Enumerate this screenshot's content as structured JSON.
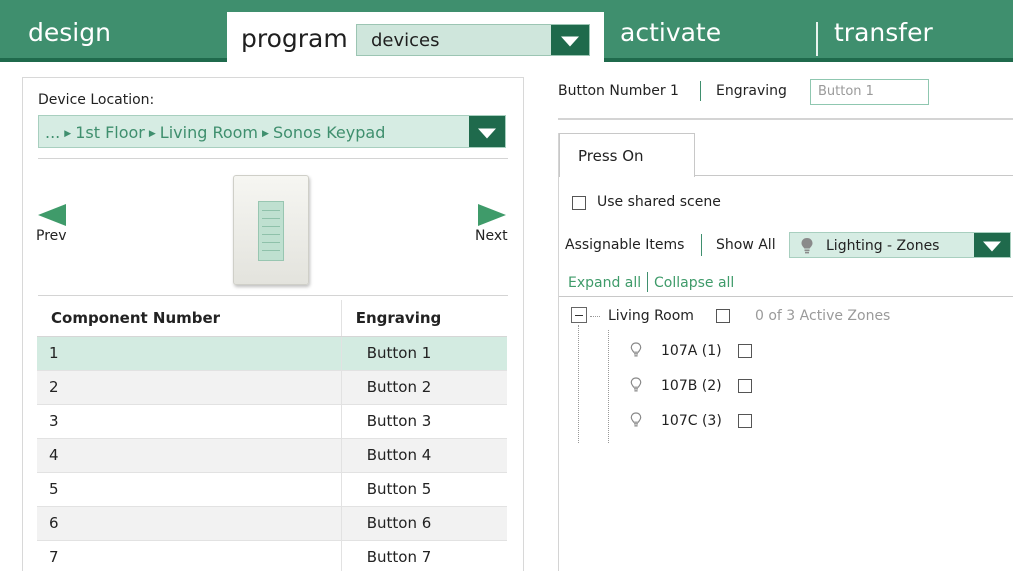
{
  "nav": {
    "design": "design",
    "program": "program",
    "devices": "devices",
    "activate": "activate",
    "transfer": "transfer"
  },
  "device": {
    "location_label": "Device Location:",
    "breadcrumb": [
      "...",
      "1st Floor",
      "Living Room",
      "Sonos Keypad"
    ],
    "prev_label": "Prev",
    "next_label": "Next"
  },
  "components": {
    "headers": [
      "Component Number",
      "Engraving"
    ],
    "rows": [
      {
        "number": "1",
        "engraving": "Button 1"
      },
      {
        "number": "2",
        "engraving": "Button 2"
      },
      {
        "number": "3",
        "engraving": "Button 3"
      },
      {
        "number": "4",
        "engraving": "Button 4"
      },
      {
        "number": "5",
        "engraving": "Button 5"
      },
      {
        "number": "6",
        "engraving": "Button 6"
      },
      {
        "number": "7",
        "engraving": "Button 7"
      }
    ],
    "selected_index": 0
  },
  "button_detail": {
    "number_label": "Button Number 1",
    "engraving_label": "Engraving",
    "engraving_value": "Button 1",
    "tab_label": "Press On",
    "shared_scene_label": "Use shared scene",
    "assignable_label": "Assignable Items",
    "show_all_label": "Show All",
    "filter_value": "Lighting - Zones",
    "expand_all": "Expand all",
    "collapse_all": "Collapse all"
  },
  "tree": {
    "room": "Living Room",
    "active_zones": "0 of 3 Active Zones",
    "zones": [
      "107A (1)",
      "107B (2)",
      "107C (3)"
    ]
  },
  "colors": {
    "brand_green": "#3f8f6e",
    "dark_green": "#1f6a4c",
    "selected_row": "#d3ebe1",
    "link_green": "#3f9b6a"
  },
  "icons": {
    "dropdown": "triangle-down",
    "prev": "triangle-left",
    "next": "triangle-right",
    "zone": "lightbulb",
    "tree_toggle": "minus-box"
  }
}
